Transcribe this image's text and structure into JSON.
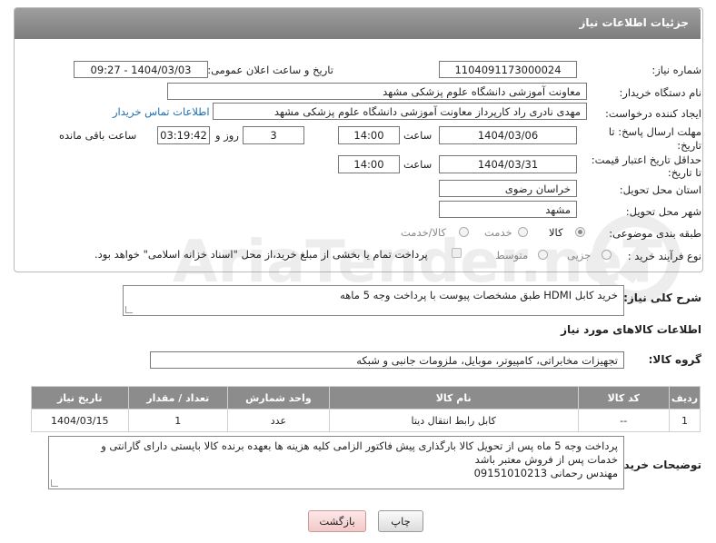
{
  "header": {
    "title": "جزئیات اطلاعات نیاز"
  },
  "fields": {
    "need_number_label": "شماره نیاز:",
    "need_number": "1104091173000024",
    "announce_label": "تاریخ و ساعت اعلان عمومی:",
    "announce_value": "1404/03/03 - 09:27",
    "buyer_org_label": "نام دستگاه خریدار:",
    "buyer_org": "معاونت آموزشی دانشگاه علوم پزشکی مشهد",
    "creator_label": "ایجاد کننده درخواست:",
    "creator": "مهدی نادری راد کارپرداز معاونت آموزشی دانشگاه علوم پزشکی مشهد",
    "contact_link": "اطلاعات تماس خریدار",
    "deadline_label": "مهلت ارسال پاسخ: تا",
    "deadline_label2": "تاریخ:",
    "deadline_date": "1404/03/06",
    "time_label": "ساعت",
    "deadline_time": "14:00",
    "days_value": "3",
    "days_label": "روز و",
    "remaining_value": "03:19:42",
    "remaining_label": "ساعت باقی مانده",
    "validity_label": "حداقل تاریخ اعتبار قیمت:",
    "validity_label2": "تا تاریخ:",
    "validity_date": "1404/03/31",
    "validity_time": "14:00",
    "province_label": "استان محل تحویل:",
    "province": "خراسان رضوی",
    "city_label": "شهر محل تحویل:",
    "city": "مشهد",
    "category_label": "طبقه بندی موضوعی:",
    "category_options": [
      "کالا",
      "خدمت",
      "کالا/خدمت"
    ],
    "category_selected": "کالا",
    "process_label": "نوع فرآیند خرید :",
    "process_options": [
      "جزیی",
      "متوسط"
    ],
    "payment_note": "پرداخت تمام یا بخشی از مبلغ خرید،از محل \"اسناد خزانه اسلامی\" خواهد بود."
  },
  "description": {
    "label": "شرح کلی نیاز:",
    "value": "خرید کابل HDMI طبق مشخصات پیوست با پرداخت وجه 5 ماهه"
  },
  "goods": {
    "section_title": "اطلاعات کالاهای مورد نیاز",
    "group_label": "گروه کالا:",
    "group_value": "تجهیزات مخابراتی، کامپیوتر، موبایل، ملزومات جانبی و شبکه",
    "columns": [
      "ردیف",
      "کد کالا",
      "نام کالا",
      "واحد شمارش",
      "تعداد / مقدار",
      "تاریخ نیاز"
    ],
    "rows": [
      [
        "1",
        "--",
        "کابل رابط انتقال دیتا",
        "عدد",
        "1",
        "1404/03/15"
      ]
    ]
  },
  "buyer_notes": {
    "label": "توضیحات خریدار:",
    "line1": "پرداخت وجه 5 ماه پس از تحویل کالا بارگذاری پیش فاکتور الزامی   کلیه هزینه ها بعهده برنده کالا بایستی دارای گارانتی و",
    "line2": "خدمات پس از فروش معتبر باشد",
    "line3": "مهندس رحمانی 09151010213"
  },
  "buttons": {
    "print": "چاپ",
    "back": "بازگشت"
  },
  "watermark": {
    "text": "AriaTender.neT"
  }
}
